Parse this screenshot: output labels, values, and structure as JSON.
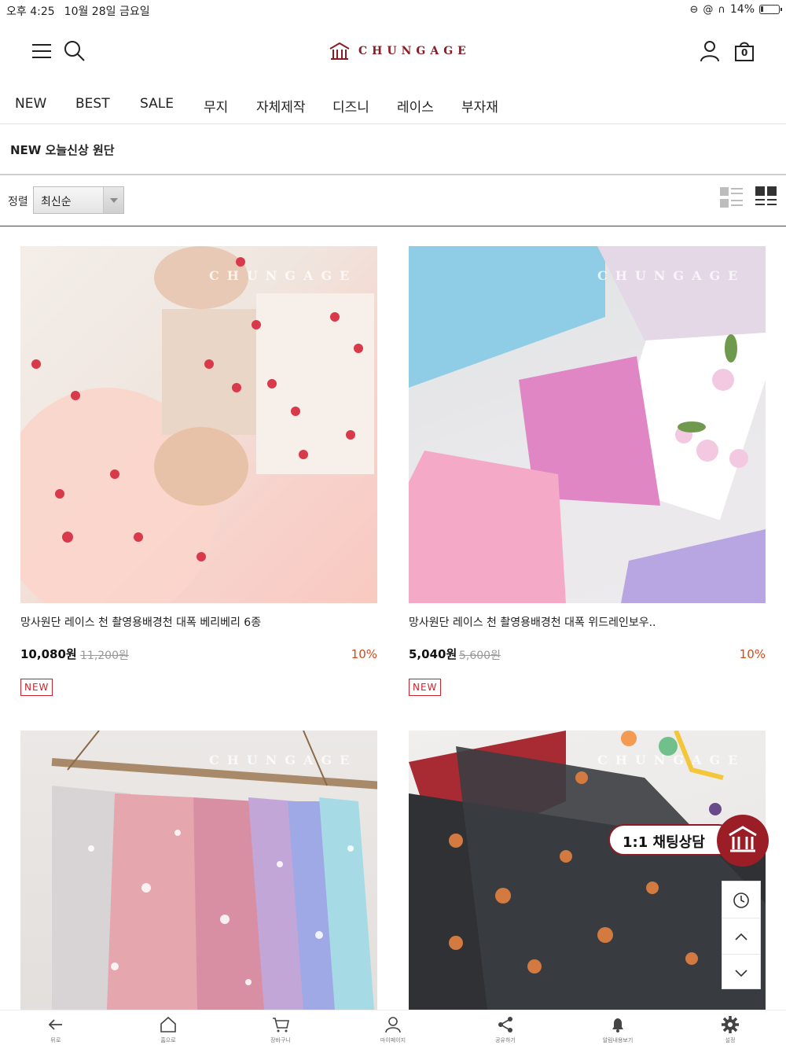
{
  "status_bar": {
    "time": "오후 4:25",
    "date": "10월 28일 금요일",
    "battery": "14%"
  },
  "header": {
    "logo_text": "CHUNGAGE",
    "cart_count": "0"
  },
  "nav": {
    "items": [
      "NEW",
      "BEST",
      "SALE",
      "무지",
      "자체제작",
      "디즈니",
      "레이스",
      "부자재"
    ]
  },
  "section": {
    "title": "NEW 오늘신상 원단"
  },
  "sort": {
    "label": "정렬",
    "selected": "최신순"
  },
  "products": [
    {
      "name": "망사원단 레이스 천 촬영용배경천 대폭 베리베리 6종",
      "price": "10,080원",
      "original_price": "11,200원",
      "discount": "10%",
      "badge": "NEW",
      "watermark": "CHUNGAGE"
    },
    {
      "name": "망사원단 레이스 천 촬영용배경천 대폭 위드레인보우..",
      "price": "5,040원",
      "original_price": "5,600원",
      "discount": "10%",
      "badge": "NEW",
      "watermark": "CHUNGAGE"
    },
    {
      "watermark": "CHUNGAGE"
    },
    {
      "watermark": "CHUNGAGE"
    }
  ],
  "chat": {
    "label": "1:1 채팅상담"
  },
  "tabbar": {
    "items": [
      "뒤로",
      "홈으로",
      "장바구니",
      "마이페이지",
      "공유하기",
      "알림내용보기",
      "설정"
    ]
  },
  "colors": {
    "brand": "#8a1c24",
    "discount": "#d04a1b",
    "badge": "#c9242b"
  }
}
